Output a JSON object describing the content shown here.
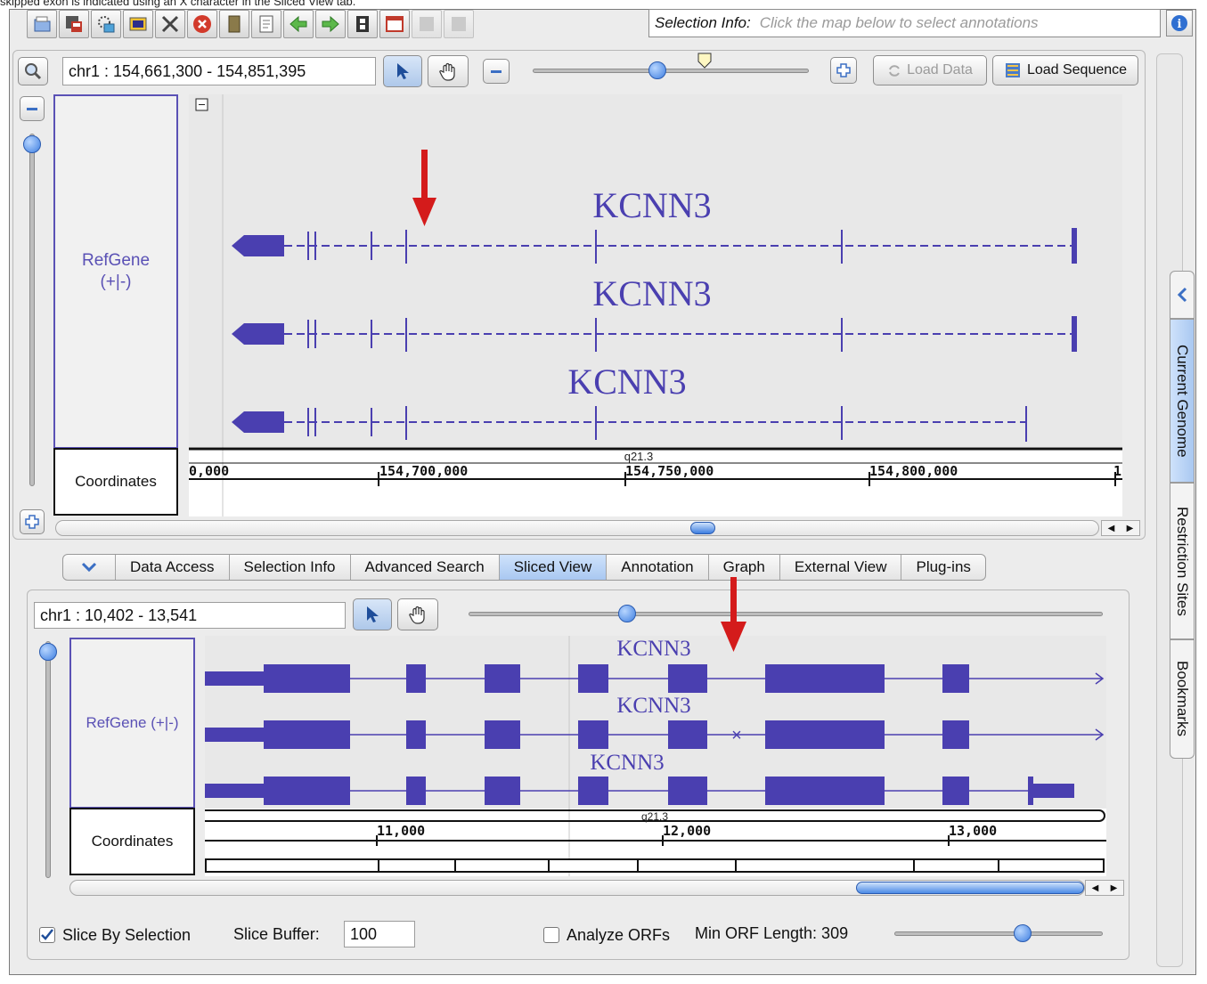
{
  "caption": "skipped exon is indicated using an X character in the Sliced View tab.",
  "toolbar": {
    "icons": [
      "open-file-icon",
      "save-icon",
      "load-genome-icon",
      "image-export-icon",
      "tools-icon",
      "stop-icon",
      "bookmark-book-icon",
      "document-icon",
      "back-arrow-icon",
      "forward-arrow-icon",
      "film-strip-icon",
      "window-icon",
      "disabled-icon-1",
      "disabled-icon-2"
    ],
    "selection_info_label": "Selection Info:",
    "selection_info_hint": "Click the map below to select annotations"
  },
  "main_view": {
    "location": "chr1 : 154,661,300 - 154,851,395",
    "load_data_label": "Load Data",
    "load_sequence_label": "Load Sequence",
    "track_label": "RefGene (+|-)",
    "track_label_line1": "RefGene",
    "track_label_line2": "(+|-)",
    "coordinates_label": "Coordinates",
    "gene_names": [
      "KCNN3",
      "KCNN3",
      "KCNN3"
    ],
    "band": "q21.3",
    "ticks": [
      "0,000",
      "154,700,000",
      "154,750,000",
      "154,800,000",
      "1"
    ]
  },
  "tabs": [
    "Data Access",
    "Selection Info",
    "Advanced Search",
    "Sliced View",
    "Annotation",
    "Graph",
    "External View",
    "Plug-ins"
  ],
  "selected_tab": "Sliced View",
  "sliced_view": {
    "location": "chr1 : 10,402 - 13,541",
    "track_label": "RefGene (+|-)",
    "coordinates_label": "Coordinates",
    "gene_names": [
      "KCNN3",
      "KCNN3",
      "KCNN3"
    ],
    "band": "q21.3",
    "ticks": [
      "11,000",
      "12,000",
      "13,000"
    ],
    "skipped_exon_marker": "×",
    "slice_by_selection_label": "Slice By Selection",
    "slice_by_selection_checked": true,
    "slice_buffer_label": "Slice Buffer:",
    "slice_buffer_value": "100",
    "analyze_orfs_label": "Analyze ORFs",
    "analyze_orfs_checked": false,
    "min_orf_label": "Min ORF Length: 309"
  },
  "side_tabs": [
    "Current Genome",
    "Restriction Sites",
    "Bookmarks"
  ],
  "colors": {
    "gene": "#4a3fb0",
    "annotation_arrow": "#d41b1b",
    "selected_tab": "#a9c8f1",
    "slider_knob": "#3d7ee0"
  }
}
